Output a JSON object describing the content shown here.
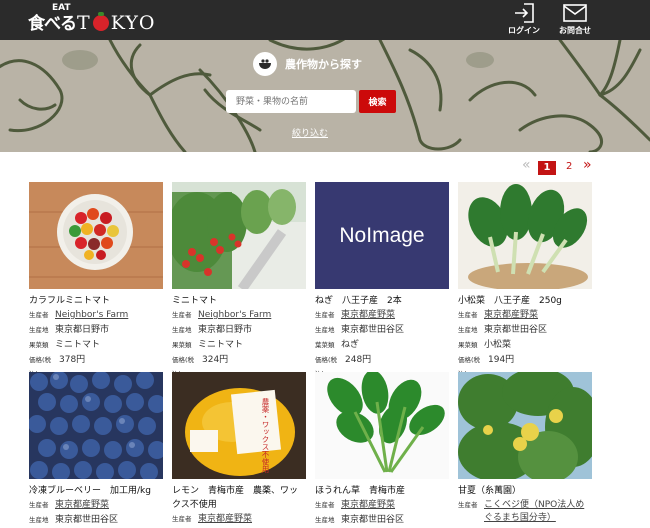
{
  "header": {
    "logo_jp": "食べる",
    "logo_eat": "EAT",
    "logo_t": "T",
    "logo_kyo": "KYO",
    "login_label": "ログイン",
    "contact_label": "お問合せ",
    "bg_color": "#2b2b2b"
  },
  "hero": {
    "title": "農作物から探す",
    "search_placeholder": "野菜・果物の名前",
    "search_button": "検索",
    "filter_label": "絞り込む"
  },
  "pagination": {
    "prev": "«",
    "current": "1",
    "page2": "2",
    "next": "»",
    "accent": "#c31414"
  },
  "labels": {
    "producer": "生産者",
    "origin": "生産地",
    "category_veg": "果菜類",
    "category_leaf": "葉菜類",
    "price": "価格(税込)"
  },
  "products": [
    {
      "name": "カラフルミニトマト",
      "producer": "Neighbor's Farm",
      "origin": "東京都日野市",
      "category_label": "果菜類",
      "category": "ミニトマト",
      "price": "378円"
    },
    {
      "name": "ミニトマト",
      "producer": "Neighbor's Farm",
      "origin": "東京都日野市",
      "category_label": "果菜類",
      "category": "ミニトマト",
      "price": "324円"
    },
    {
      "name": "ねぎ　八王子産　2本",
      "producer": "東京都産野菜",
      "origin": "東京都世田谷区",
      "category_label": "葉菜類",
      "category": "ねぎ",
      "price": "248円",
      "noimage": "NoImage"
    },
    {
      "name": "小松菜　八王子産　250g",
      "producer": "東京都産野菜",
      "origin": "東京都世田谷区",
      "category_label": "果菜類",
      "category": "小松菜",
      "price": "194円"
    },
    {
      "name": "冷凍ブルーベリー　加工用/kg",
      "producer": "東京都産野菜",
      "origin": "東京都世田谷区"
    },
    {
      "name": "レモン　青梅市産　農薬、ワックス不使用",
      "producer": "東京都産野菜"
    },
    {
      "name": "ほうれん草　青梅市産",
      "producer": "東京都産野菜",
      "origin": "東京都世田谷区"
    },
    {
      "name": "甘夏（糸萬園）",
      "producer": "こくベジ便（NPO法人めぐるまち国分寺）"
    }
  ],
  "lemon_sign": "農薬・ワックス不使用"
}
